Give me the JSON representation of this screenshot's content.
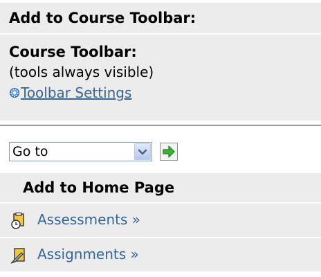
{
  "course_toolbar_header": {
    "title": "Add to Course Toolbar:"
  },
  "course_toolbar": {
    "title": "Course Toolbar:",
    "subtitle": "(tools always visible)",
    "settings_link": "Toolbar Settings",
    "settings_icon": "gear-icon"
  },
  "goto": {
    "selected": "Go to",
    "go_icon": "green-arrow-right-icon"
  },
  "home_page": {
    "title": "Add to Home Page",
    "items": [
      {
        "label": "Assessments »",
        "icon": "assessments-icon"
      },
      {
        "label": "Assignments »",
        "icon": "assignments-icon"
      }
    ]
  },
  "colors": {
    "panel_bg": "#ececec",
    "link": "#336699",
    "separator": "#a0a0a0"
  }
}
